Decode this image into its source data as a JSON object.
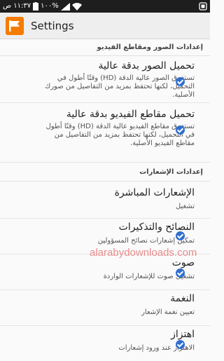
{
  "status_bar": {
    "time": "١١:٣٧ ص",
    "battery": "١٠٠%"
  },
  "app": {
    "title": "Settings"
  },
  "sections": [
    {
      "header": "إعدادات الصور ومقاطع الفيديو",
      "items": [
        {
          "title": "تحميل الصور بدقة عالية",
          "summary": "تستغرق الصور عالية الدقة (HD) وقتًا أطول في التحميل، لكنها تحتفظ بمزيد من التفاصيل من صورك الأصلية.",
          "checked": true
        },
        {
          "title": "تحميل مقاطع الفيديو بدقة عالية",
          "summary": "تستغرق مقاطع الفيديو عالية الدقة (HD) وقتًا أطول في التحميل، لكنها تحتفظ بمزيد من التفاصيل من مقاطع الفيديو الأصلية.",
          "checked": true
        }
      ]
    },
    {
      "header": "إعدادات الإشعارات",
      "items": [
        {
          "title": "الإشعارات المباشرة",
          "summary": "تشغيل",
          "checked": false
        },
        {
          "title": "النصائح والتذكيرات",
          "summary": "تمكين إشعارات نصائح المسؤولين",
          "checked": true
        },
        {
          "title": "صوت",
          "summary": "تشغيل صوت للإشعارات الواردة",
          "checked": true
        },
        {
          "title": "النغمة",
          "summary": "تعيين نغمة الإشعار",
          "checked": false
        },
        {
          "title": "اهتزاز",
          "summary": "الاهتزاز عند ورود إشعارات",
          "checked": true
        }
      ]
    }
  ],
  "watermark": "alarabydownloads.com",
  "colors": {
    "check": "#2f6fd0",
    "appbar": "#eeeeee",
    "status_bar": "#1e1e1e",
    "app_icon": "#f57c00"
  },
  "icons": [
    "signal-icon",
    "wifi-icon",
    "battery-icon",
    "settings-app-icon",
    "check-icon"
  ]
}
